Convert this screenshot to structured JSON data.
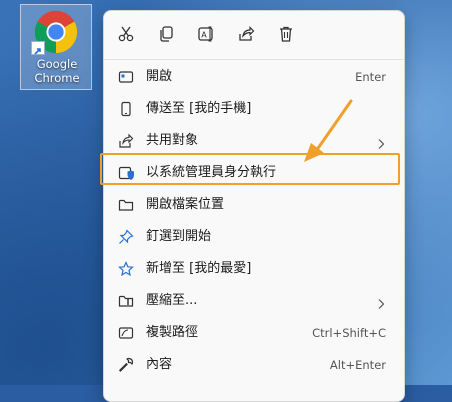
{
  "desktop": {
    "icon_label_line1": "Google",
    "icon_label_line2": "Chrome"
  },
  "quick_actions": [
    {
      "name": "cut",
      "icon": "scissors-icon"
    },
    {
      "name": "copy",
      "icon": "copy-icon"
    },
    {
      "name": "rename",
      "icon": "rename-icon"
    },
    {
      "name": "share",
      "icon": "share-icon"
    },
    {
      "name": "delete",
      "icon": "trash-icon"
    }
  ],
  "menu": {
    "items": [
      {
        "label": "開啟",
        "shortcut": "Enter",
        "icon": "open-app-icon"
      },
      {
        "label": "傳送至 [我的手機]",
        "shortcut": "",
        "icon": "phone-icon"
      },
      {
        "label": "共用對象",
        "shortcut": "",
        "icon": "share-icon",
        "submenu": true
      },
      {
        "label": "以系統管理員身分執行",
        "shortcut": "",
        "icon": "admin-shield-icon",
        "highlighted": true
      },
      {
        "label": "開啟檔案位置",
        "shortcut": "",
        "icon": "folder-icon"
      },
      {
        "label": "釘選到開始",
        "shortcut": "",
        "icon": "pin-icon"
      },
      {
        "label": "新增至 [我的最愛]",
        "shortcut": "",
        "icon": "star-icon"
      },
      {
        "label": "壓縮至...",
        "shortcut": "",
        "icon": "zip-folder-icon",
        "submenu": true
      },
      {
        "label": "複製路徑",
        "shortcut": "Ctrl+Shift+C",
        "icon": "copy-path-icon"
      },
      {
        "label": "內容",
        "shortcut": "Alt+Enter",
        "icon": "wrench-icon"
      }
    ]
  },
  "colors": {
    "highlight_border": "#f0a028",
    "annotation_arrow": "#f0a028",
    "menu_bg": "#f9f9f9"
  }
}
